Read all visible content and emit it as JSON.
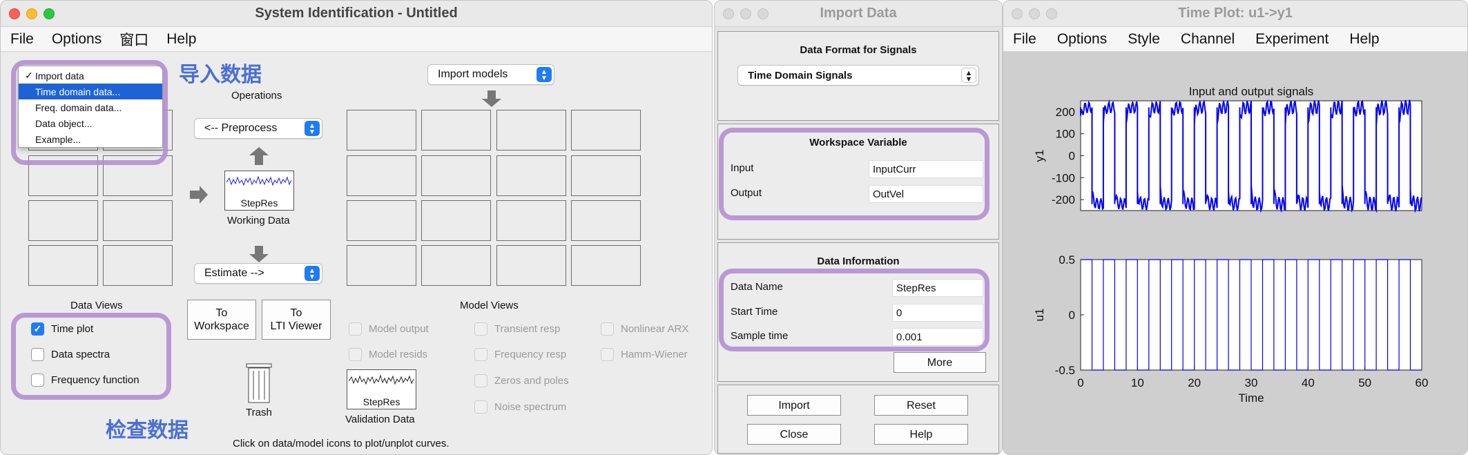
{
  "sysid": {
    "title": "System Identification - Untitled",
    "menu": [
      "File",
      "Options",
      "窗口",
      "Help"
    ],
    "import_data_menu": {
      "items": [
        "Import data",
        "Time domain data...",
        "Freq. domain data...",
        "Data object...",
        "Example..."
      ],
      "checked": "✓"
    },
    "import_models_label": "Import models",
    "operations_label": "Operations",
    "preprocess_label": "<-- Preprocess",
    "working_data_name": "StepRes",
    "working_data_label": "Working Data",
    "estimate_label": "Estimate -->",
    "data_views_label": "Data Views",
    "data_views": [
      {
        "label": "Time plot",
        "checked": true
      },
      {
        "label": "Data spectra",
        "checked": false
      },
      {
        "label": "Frequency function",
        "checked": false
      }
    ],
    "to_workspace_label": "To\nWorkspace",
    "to_lti_label": "To\nLTI Viewer",
    "trash_label": "Trash",
    "validation_data_name": "StepRes",
    "validation_data_label": "Validation Data",
    "model_views_label": "Model Views",
    "model_views": [
      "Model output",
      "Transient resp",
      "Nonlinear ARX",
      "Model resids",
      "Frequency resp",
      "Hamm-Wiener",
      "Zeros and poles",
      "Noise spectrum"
    ],
    "hint": "Click on data/model icons to plot/unplot curves.",
    "annotation_import": "导入数据",
    "annotation_check": "检查数据"
  },
  "import": {
    "title": "Import Data",
    "format_heading": "Data Format for Signals",
    "format_value": "Time Domain Signals",
    "workspace_heading": "Workspace Variable",
    "input_label": "Input",
    "input_value": "InputCurr",
    "output_label": "Output",
    "output_value": "OutVel",
    "info_heading": "Data Information",
    "data_name_label": "Data Name",
    "data_name_value": "StepRes",
    "start_time_label": "Start Time",
    "start_time_value": "0",
    "sample_time_label": "Sample time",
    "sample_time_value": "0.001",
    "more_label": "More",
    "import_label": "Import",
    "reset_label": "Reset",
    "close_label": "Close",
    "help_label": "Help"
  },
  "timeplot": {
    "title": "Time Plot: u1->y1",
    "menu": [
      "File",
      "Options",
      "Style",
      "Channel",
      "Experiment",
      "Help"
    ]
  },
  "chart_data": [
    {
      "type": "line",
      "title": "Input and output signals",
      "ylabel": "y1",
      "xlim": [
        0,
        60
      ],
      "ylim": [
        -250,
        250
      ],
      "yticks": [
        200,
        100,
        0,
        -100,
        -200
      ],
      "series": [
        {
          "description": "square-wave response switching between about 220 and -220 every 2 s",
          "period": 4,
          "high": 220,
          "low": -220
        }
      ],
      "color": "#0000ff"
    },
    {
      "type": "line",
      "title": "",
      "xlabel": "Time",
      "ylabel": "u1",
      "xlim": [
        0,
        60
      ],
      "ylim": [
        -0.5,
        0.5
      ],
      "xticks": [
        0,
        10,
        20,
        30,
        40,
        50,
        60
      ],
      "yticks": [
        0.5,
        0,
        -0.5
      ],
      "series": [
        {
          "description": "square wave input between 0.5 and -0.5, period 4 s",
          "period": 4,
          "high": 0.5,
          "low": -0.5
        }
      ],
      "color": "#0000ff"
    }
  ]
}
